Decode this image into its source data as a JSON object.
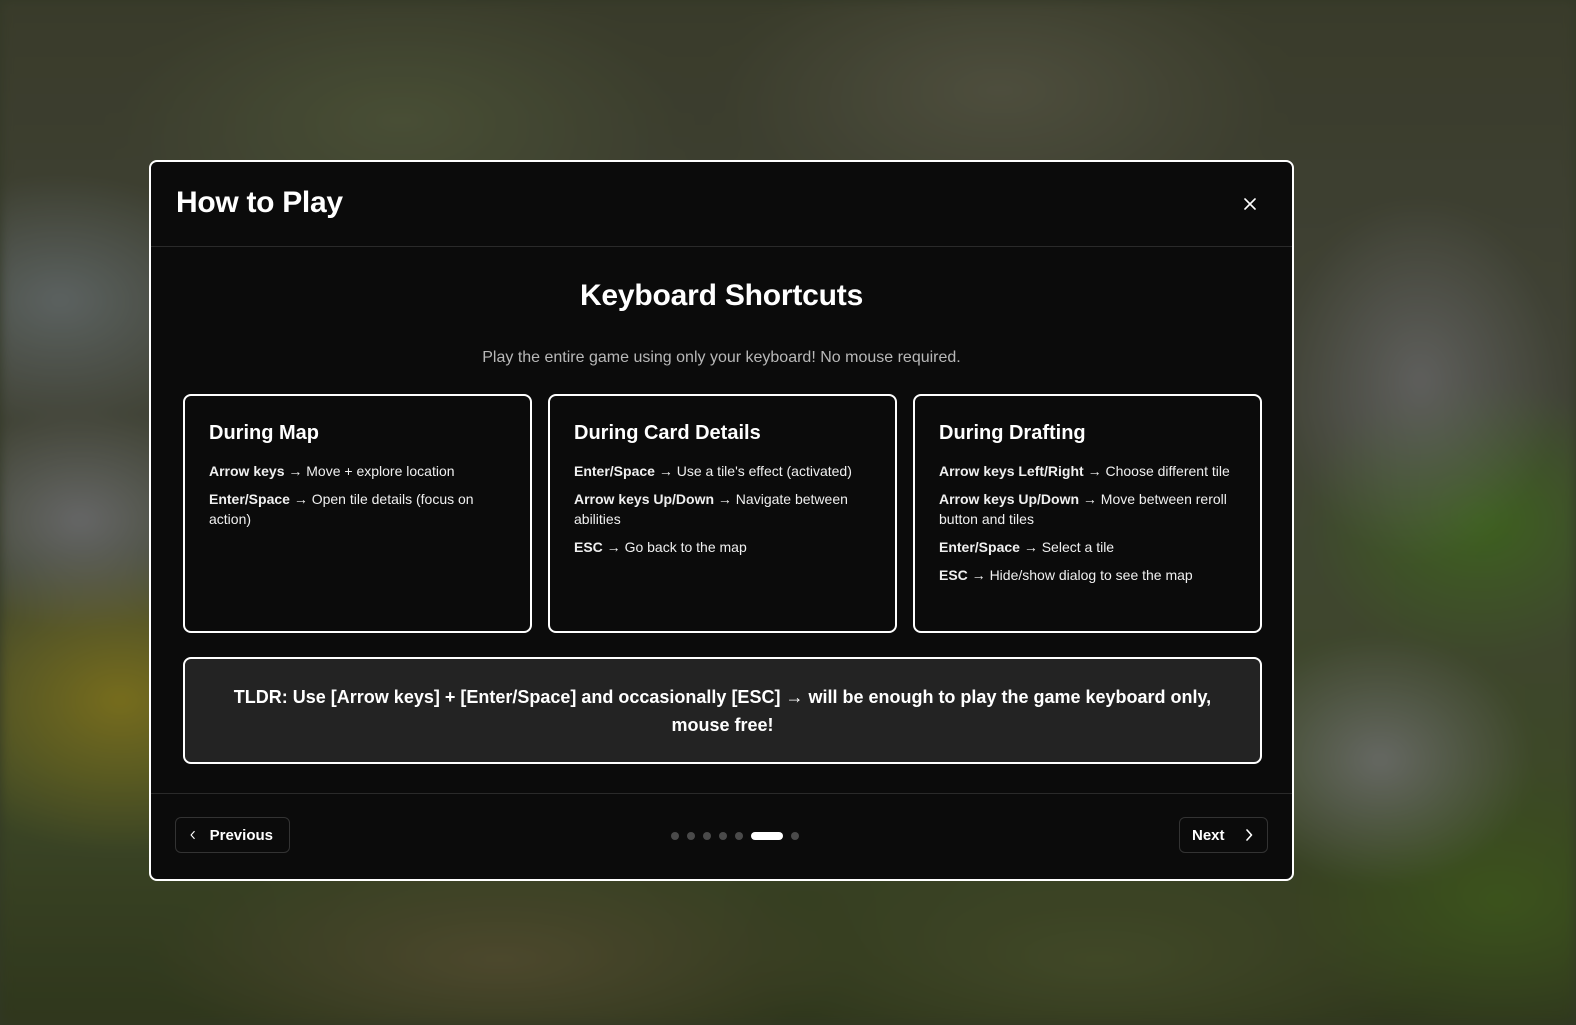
{
  "modal": {
    "title": "How to Play",
    "close_icon": "close-icon"
  },
  "section": {
    "title": "Keyboard Shortcuts",
    "subtitle": "Play the entire game using only your keyboard! No mouse required."
  },
  "cards": [
    {
      "title": "During Map",
      "shortcuts": [
        {
          "key": "Arrow keys",
          "action": " → Move + explore location"
        },
        {
          "key": "Enter/Space",
          "action": " → Open tile details (focus on action)"
        }
      ]
    },
    {
      "title": "During Card Details",
      "shortcuts": [
        {
          "key": "Enter/Space",
          "action": " → Use a tile's effect (activated)"
        },
        {
          "key": "Arrow keys Up/Down",
          "action": " → Navigate between abilities"
        },
        {
          "key": "ESC",
          "action": " → Go back to the map"
        }
      ]
    },
    {
      "title": "During Drafting",
      "shortcuts": [
        {
          "key": "Arrow keys Left/Right",
          "action": " → Choose different tile"
        },
        {
          "key": "Arrow keys Up/Down",
          "action": " → Move between reroll button and tiles"
        },
        {
          "key": "Enter/Space",
          "action": " → Select a tile"
        },
        {
          "key": "ESC",
          "action": " → Hide/show dialog to see the map"
        }
      ]
    }
  ],
  "tldr": "TLDR: Use [Arrow keys] + [Enter/Space] and occasionally [ESC] → will be enough to play the game keyboard only, mouse free!",
  "footer": {
    "previous_label": "Previous",
    "next_label": "Next",
    "page_count": 7,
    "current_page": 6
  }
}
